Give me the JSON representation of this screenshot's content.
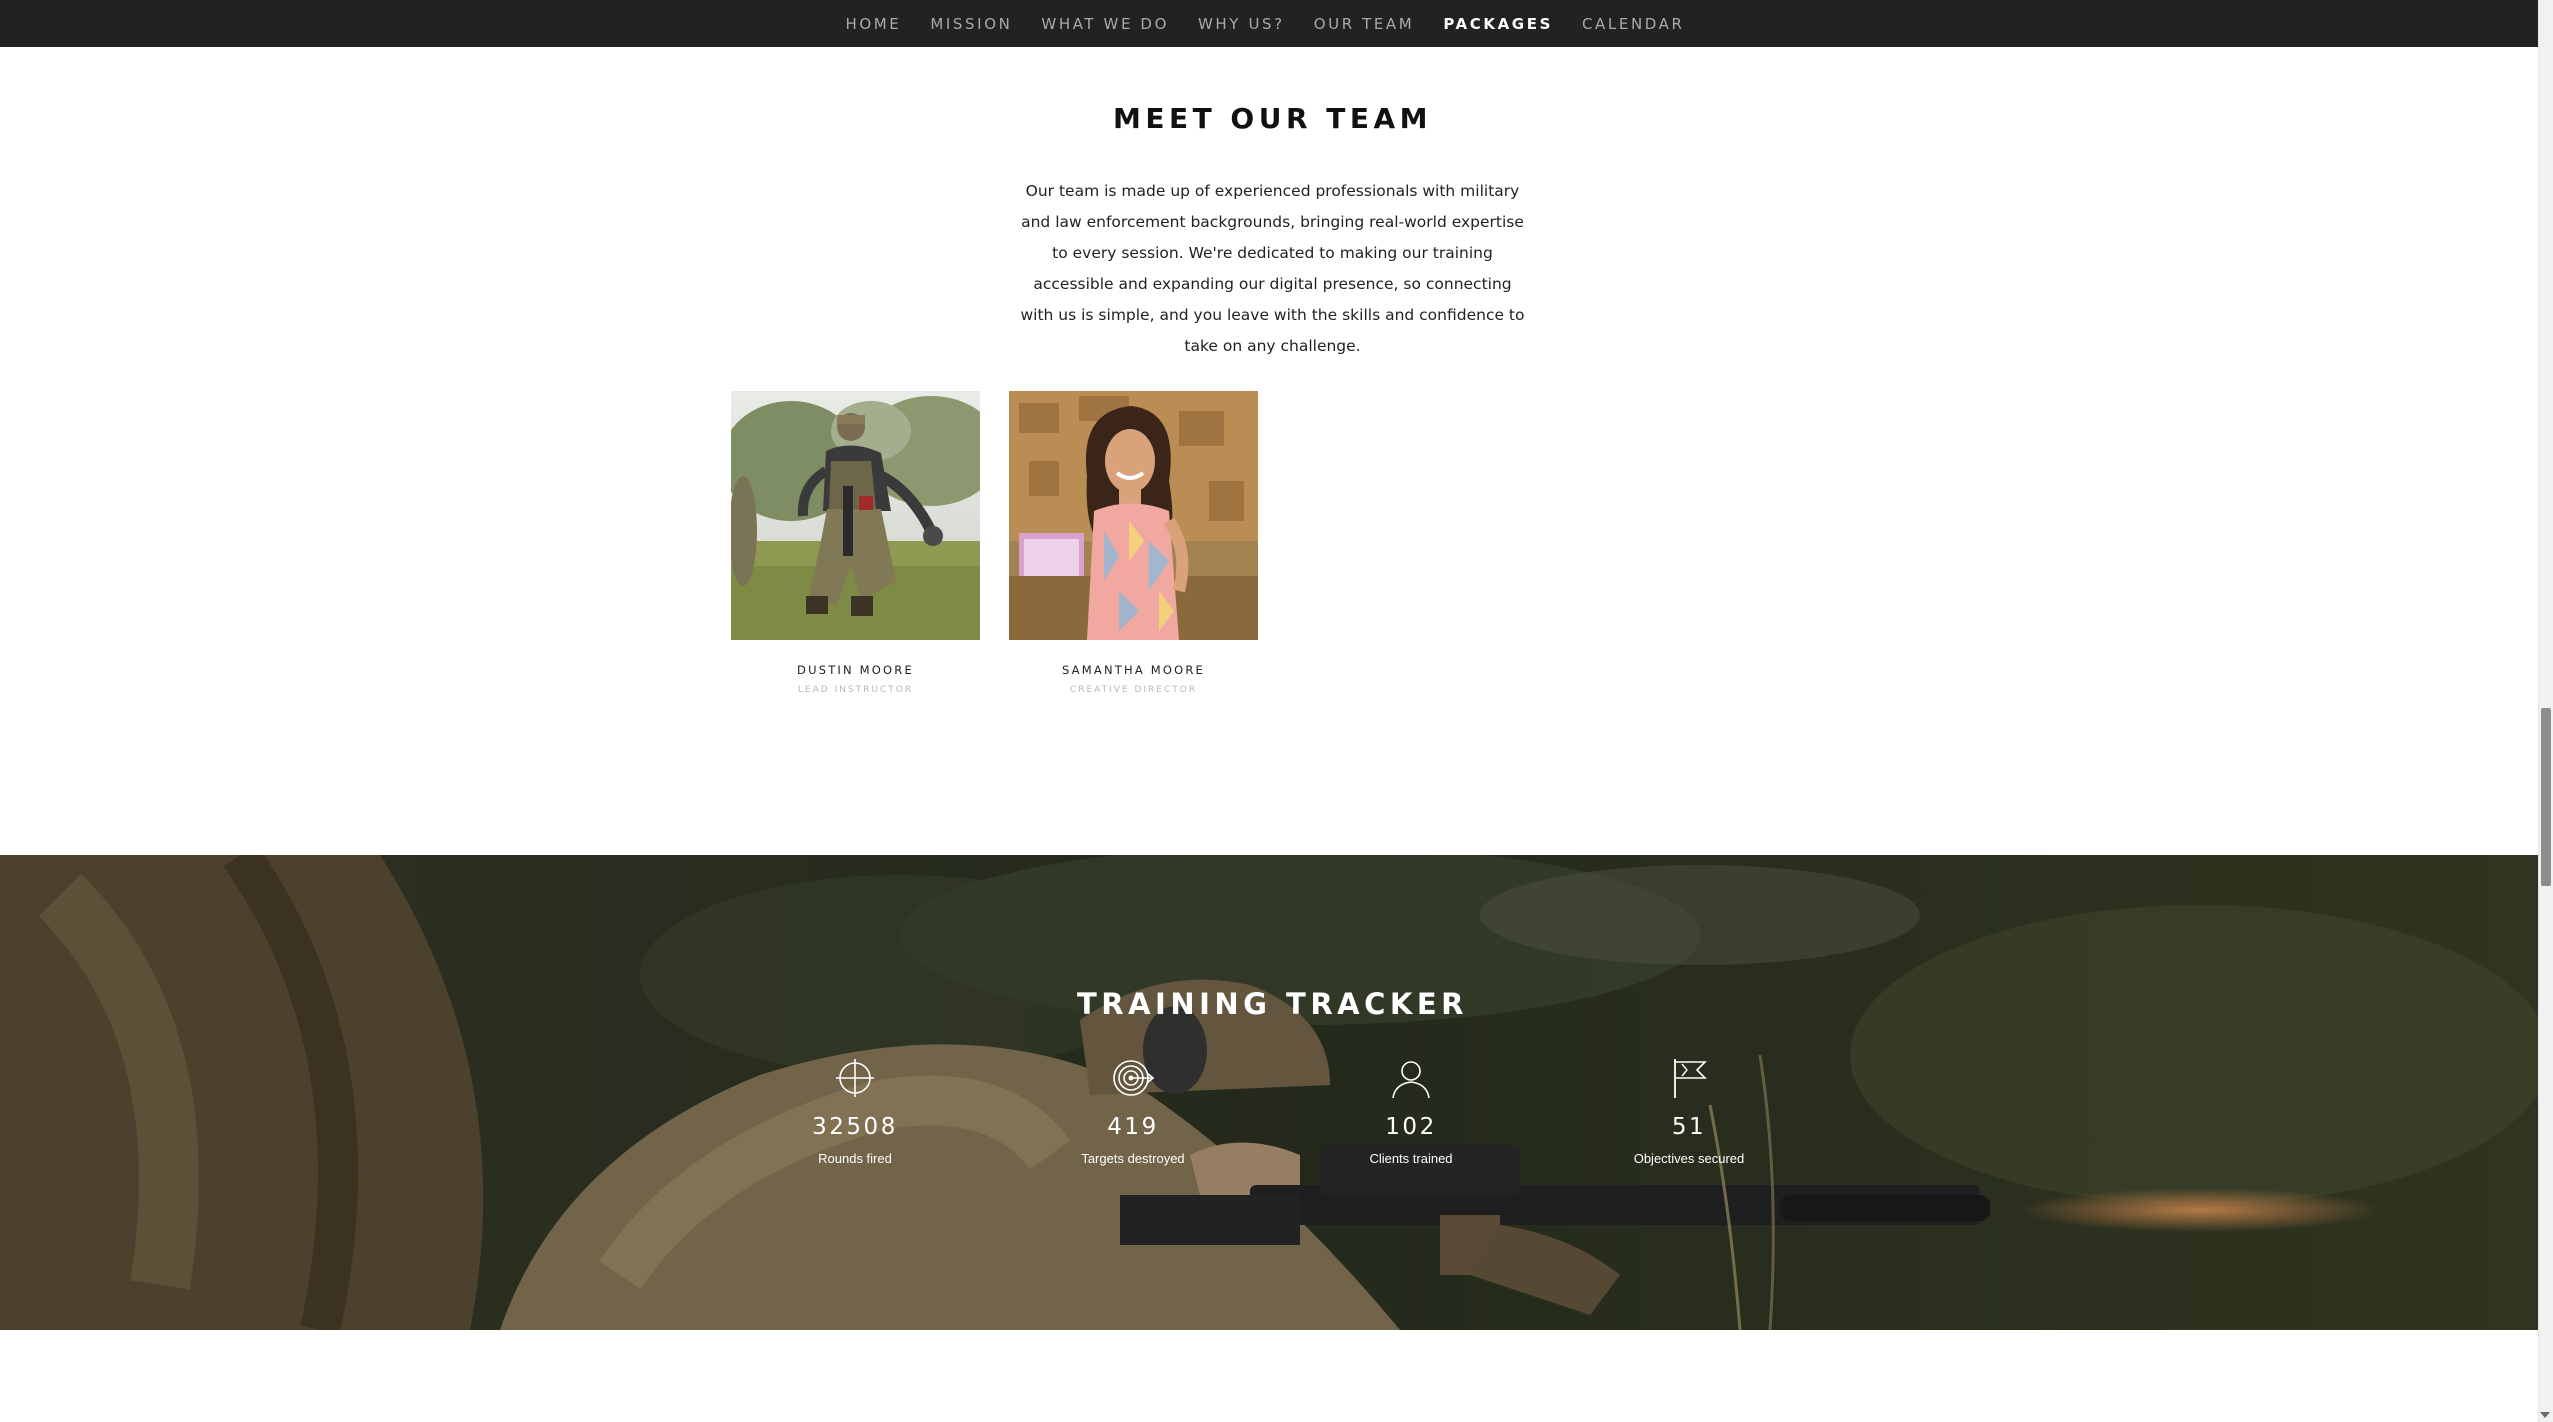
{
  "nav": {
    "items": [
      {
        "label": "HOME",
        "active": false
      },
      {
        "label": "MISSION",
        "active": false
      },
      {
        "label": "WHAT WE DO",
        "active": false
      },
      {
        "label": "WHY US?",
        "active": false
      },
      {
        "label": "OUR TEAM",
        "active": false
      },
      {
        "label": "PACKAGES",
        "active": true
      },
      {
        "label": "CALENDAR",
        "active": false
      }
    ]
  },
  "team": {
    "title": "MEET OUR TEAM",
    "description": "Our team is made up of experienced professionals with military and law enforcement backgrounds, bringing real-world expertise to every session. We're dedicated to making our training accessible and expanding our digital presence, so connecting with us is simple, and you leave with the skills and confidence to take on any challenge.",
    "members": [
      {
        "name": "DUSTIN MOORE",
        "role": "LEAD INSTRUCTOR"
      },
      {
        "name": "SAMANTHA MOORE",
        "role": "CREATIVE DIRECTOR"
      }
    ]
  },
  "tracker": {
    "title": "TRAINING TRACKER",
    "counters": [
      {
        "icon": "crosshair-icon",
        "value": "32508",
        "label": "Rounds fired"
      },
      {
        "icon": "target-arrow-icon",
        "value": "419",
        "label": "Targets destroyed"
      },
      {
        "icon": "user-icon",
        "value": "102",
        "label": "Clients trained"
      },
      {
        "icon": "flag-icon",
        "value": "51",
        "label": "Objectives secured"
      }
    ]
  },
  "colors": {
    "nav_bg": "#222222",
    "nav_text": "#a9a9a9",
    "nav_active": "#ffffff",
    "page_bg": "#ffffff",
    "role_text": "#b8b8b8"
  }
}
